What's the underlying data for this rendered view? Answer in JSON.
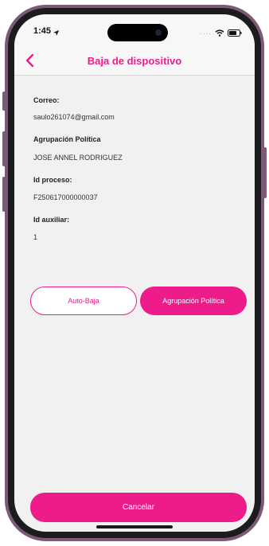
{
  "status_bar": {
    "time": "1:45",
    "icons": [
      "location-arrow-icon",
      "wifi-icon",
      "battery-icon"
    ]
  },
  "nav": {
    "back_icon": "chevron-left-icon",
    "title": "Baja de dispositivo"
  },
  "fields": [
    {
      "label": "Correo:",
      "value": "saulo261074@gmail.com"
    },
    {
      "label": "Agrupación Política",
      "value": "JOSE ANNEL RODRIGUEZ"
    },
    {
      "label": "Id proceso:",
      "value": "F250617000000037"
    },
    {
      "label": "Id auxiliar:",
      "value": "1"
    }
  ],
  "actions": {
    "auto_baja": "Auto-Baja",
    "agrupacion": "Agrupación Política",
    "cancelar": "Cancelar"
  },
  "colors": {
    "accent": "#ee1c8a",
    "background": "#f1f1f1",
    "frame": "#7a5a76"
  }
}
